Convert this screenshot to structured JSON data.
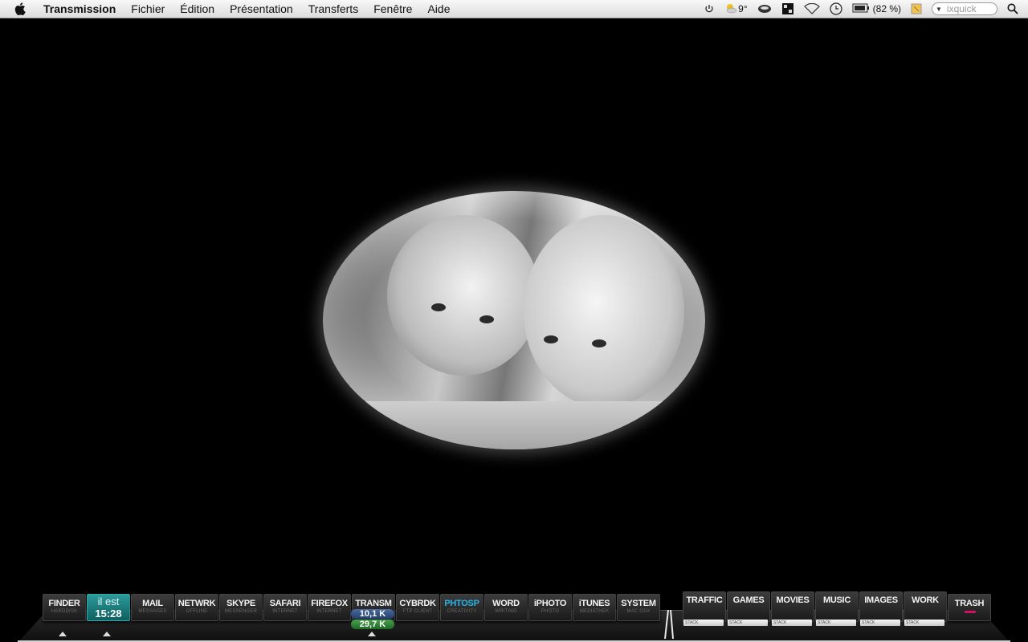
{
  "menubar": {
    "app_name": "Transmission",
    "menus": [
      "Fichier",
      "Édition",
      "Présentation",
      "Transferts",
      "Fenêtre",
      "Aide"
    ],
    "weather_temp": "9°",
    "battery_text": "(82 %)",
    "search_placeholder": "ixquick"
  },
  "dock": {
    "apps": [
      {
        "label": "FINDER",
        "sub": "HARDDISK"
      },
      {
        "label": "MAIL",
        "sub": "MESSAGES"
      },
      {
        "label": "NETWRK",
        "sub": "OFFLINE"
      },
      {
        "label": "SKYPE",
        "sub": "MESSENGER"
      },
      {
        "label": "SAFARI",
        "sub": "INTERNET"
      },
      {
        "label": "FIREFOX",
        "sub": "INTERNET"
      },
      {
        "label": "TRANSM",
        "sub": ""
      },
      {
        "label": "CYBRDK",
        "sub": "FTP CLIENT"
      },
      {
        "label": "PHTOSP",
        "sub": "CREATIVITY"
      },
      {
        "label": "WORD",
        "sub": "WRITING"
      },
      {
        "label": "iPHOTO",
        "sub": "PHOTO"
      },
      {
        "label": "iTUNES",
        "sub": "MEDIATHEK"
      },
      {
        "label": "SYSTEM",
        "sub": "MAC OSX"
      }
    ],
    "clock": {
      "line1": "il est",
      "line2": "15:28"
    },
    "transmission": {
      "down": "10,1 K",
      "up": "29,7 K"
    },
    "stacks": [
      {
        "label": "TRAFFIC",
        "tag": "STACK"
      },
      {
        "label": "GAMES",
        "tag": "STACK"
      },
      {
        "label": "MOVIES",
        "tag": "STACK"
      },
      {
        "label": "MUSIC",
        "tag": "STACK"
      },
      {
        "label": "IMAGES",
        "tag": "STACK"
      },
      {
        "label": "WORK",
        "tag": "STACK"
      }
    ],
    "trash": {
      "label": "TRASH"
    }
  },
  "colors": {
    "accent": "#27b4e6",
    "clock": "#2c9b9b"
  }
}
